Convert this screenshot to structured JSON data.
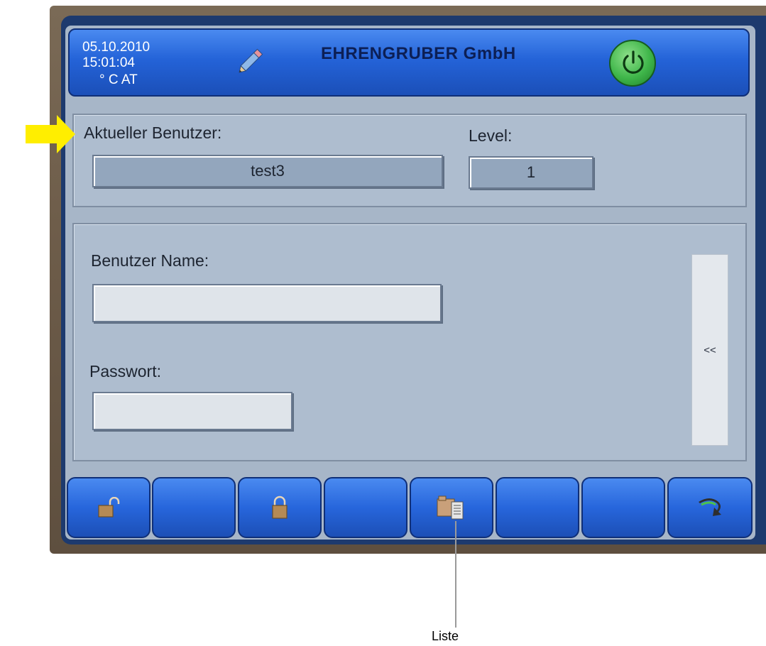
{
  "header": {
    "date": "05.10.2010",
    "time": "15:01:04",
    "unit_region": "° C  AT",
    "title": "EHRENGRUBER GmbH",
    "edit_icon": "pencil-icon",
    "power_icon": "power-icon"
  },
  "current_user": {
    "label": "Aktueller Benutzer:",
    "value": "test3",
    "level_label": "Level:",
    "level_value": "1"
  },
  "login": {
    "username_label": "Benutzer Name:",
    "username_value": "",
    "password_label": "Passwort:",
    "password_value": "",
    "side_button_label": "<<"
  },
  "toolbar": [
    {
      "icon": "unlock-icon"
    },
    {
      "icon": ""
    },
    {
      "icon": "lock-icon"
    },
    {
      "icon": ""
    },
    {
      "icon": "list-icon"
    },
    {
      "icon": ""
    },
    {
      "icon": ""
    },
    {
      "icon": "back-arrow-icon"
    }
  ],
  "annotation": {
    "caption": "Liste"
  },
  "colors": {
    "header_blue": "#2463d8",
    "panel_gray": "#aebdcf",
    "power_green": "#3fb64a",
    "arrow_yellow": "#ffee00"
  }
}
